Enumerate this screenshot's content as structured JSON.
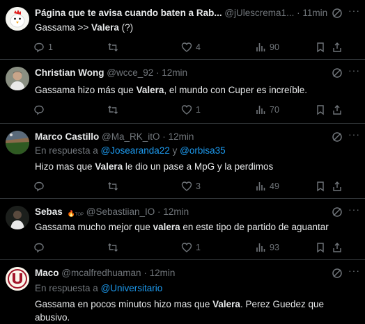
{
  "tweets": [
    {
      "name": "Página que te avisa cuando baten a Rab...",
      "handle": "@jUlescrema1...",
      "dot": "·",
      "time": "11min",
      "reply_prefix": "",
      "reply_to": [],
      "text_parts": [
        "Gassama >> ",
        "Valera",
        "  (?)"
      ],
      "replies": "1",
      "retweets": "",
      "likes": "4",
      "views": "90",
      "avatar": "chicken-avatar"
    },
    {
      "name": "Christian Wong",
      "handle": "@wcce_92",
      "dot": "·",
      "time": "12min",
      "reply_prefix": "",
      "reply_to": [],
      "text_parts": [
        "Gassama hizo más que ",
        "Valera",
        ", el mundo con Cuper es increíble."
      ],
      "replies": "",
      "retweets": "",
      "likes": "1",
      "views": "70",
      "avatar": "person-avatar"
    },
    {
      "name": "Marco Castillo",
      "handle": "@Ma_RK_itO",
      "dot": "·",
      "time": "12min",
      "reply_prefix": "En respuesta a ",
      "reply_to": [
        "@Josearanda22",
        "@orbisa35"
      ],
      "reply_joiner": " y ",
      "text_parts": [
        "Hizo mas que ",
        "Valera",
        " le dio un pase a MpG y la perdimos"
      ],
      "replies": "",
      "retweets": "",
      "likes": "3",
      "views": "49",
      "avatar": "stadium-avatar"
    },
    {
      "name": "Sebas",
      "handle": "@Sebastiian_IO",
      "dot": "·",
      "time": "12min",
      "reply_prefix": "",
      "reply_to": [],
      "text_parts": [
        "Gassama mucho mejor que ",
        "valera",
        " en este tipo de partido de aguantar"
      ],
      "replies": "",
      "retweets": "",
      "likes": "1",
      "views": "93",
      "avatar": "dark-person-avatar"
    },
    {
      "name": "Maco",
      "handle": "@mcalfredhuaman",
      "dot": "·",
      "time": "12min",
      "reply_prefix": "En respuesta a ",
      "reply_to": [
        "@Universitario"
      ],
      "reply_joiner": "",
      "text_parts": [
        "Gassama en pocos minutos hizo mas que ",
        "Valera",
        ". Perez Guedez que abusivo."
      ],
      "replies": "",
      "retweets": "",
      "likes": "",
      "views": "",
      "avatar": "universitario-logo-avatar"
    }
  ],
  "labels": {
    "sebas_badge": "TOP"
  },
  "colors": {
    "background": "#000000",
    "text": "#e7e9ea",
    "muted": "#71767b",
    "link": "#1d9bf0",
    "divider": "#2f3336"
  }
}
